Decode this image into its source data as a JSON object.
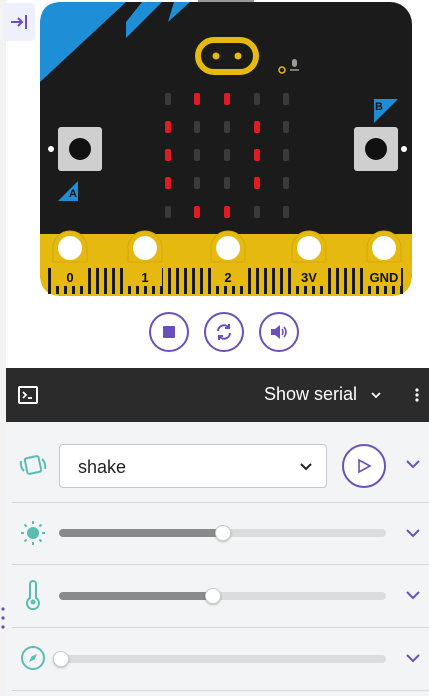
{
  "board": {
    "pins": [
      "0",
      "1",
      "2",
      "3V",
      "GND"
    ],
    "button_a": "A",
    "button_b": "B",
    "led_matrix": [
      [
        0,
        1,
        1,
        0,
        0
      ],
      [
        1,
        0,
        0,
        1,
        0
      ],
      [
        1,
        0,
        0,
        1,
        0
      ],
      [
        1,
        0,
        0,
        1,
        0
      ],
      [
        0,
        1,
        1,
        0,
        0
      ]
    ]
  },
  "controls": {
    "icons": [
      "stop-icon",
      "restart-icon",
      "sound-icon"
    ]
  },
  "serial": {
    "label": "Show serial"
  },
  "sensors": {
    "gesture": {
      "selected": "shake"
    },
    "light_level": 0.5,
    "temperature_level": 0.47,
    "compass_level": 0.0
  },
  "colors": {
    "accent": "#6b4fbb",
    "board": "#1b1b1b",
    "pins": "#e5b90f",
    "corner": "#1e8fd6",
    "led_on": "#e01b24",
    "icons_teal": "#5bbdb1"
  }
}
